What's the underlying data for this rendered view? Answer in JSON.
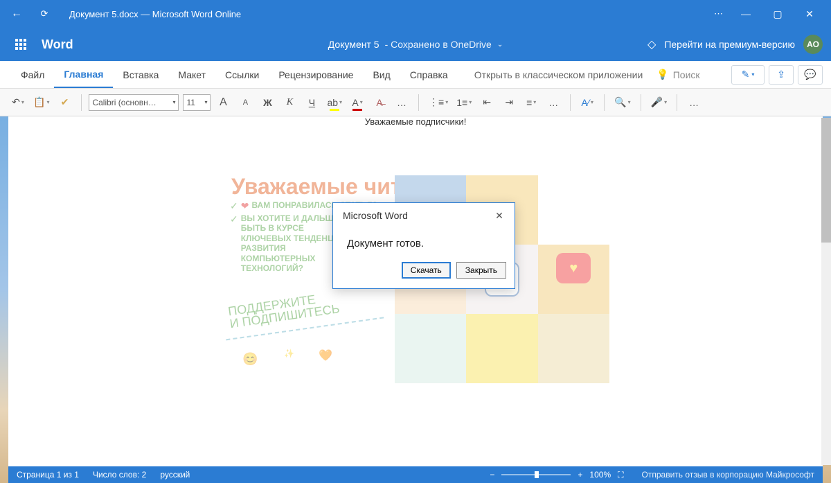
{
  "titlebar": {
    "title": "Документ 5.docx — Microsoft Word Online"
  },
  "appbar": {
    "app_name": "Word",
    "doc_name": "Документ 5",
    "saved_status": "-  Сохранено в OneDrive",
    "premium": "Перейти на премиум-версию",
    "avatar_initials": "АО"
  },
  "tabs": {
    "file": "Файл",
    "home": "Главная",
    "insert": "Вставка",
    "layout": "Макет",
    "references": "Ссылки",
    "review": "Рецензирование",
    "view": "Вид",
    "help": "Справка",
    "open_desktop": "Открыть в классическом приложении",
    "search_placeholder": "Поиск"
  },
  "ribbon": {
    "font_name": "Calibri (основн…",
    "font_size": "11",
    "grow_font": "A",
    "shrink_font": "A",
    "bold": "Ж",
    "italic": "К",
    "underline": "Ч",
    "more": "…"
  },
  "document": {
    "greeting": "Уважаемые подписчики!"
  },
  "flyer": {
    "headline": "Уважаемые читатели!",
    "bullet1_prefix": "ВАМ",
    "bullet1": "ПОНРАВИЛАСЬ СТАТЬЯ?",
    "bullet2": "ВЫ ХОТИТЕ И ДАЛЬШЕ БЫТЬ В КУРСЕ КЛЮЧЕВЫХ ТЕНДЕНЦИЙ РАЗВИТИЯ КОМПЬЮТЕРНЫХ ТЕХНОЛОГИЙ?",
    "script1": "ПОДДЕРЖИТЕ",
    "script2": "И ПОДПИШИТЕСЬ"
  },
  "dialog": {
    "title": "Microsoft Word",
    "message": "Документ готов.",
    "download": "Скачать",
    "close": "Закрыть"
  },
  "status": {
    "page": "Страница 1 из 1",
    "words": "Число слов: 2",
    "language": "русский",
    "zoom": "100%",
    "feedback": "Отправить отзыв в корпорацию Майкрософт"
  }
}
